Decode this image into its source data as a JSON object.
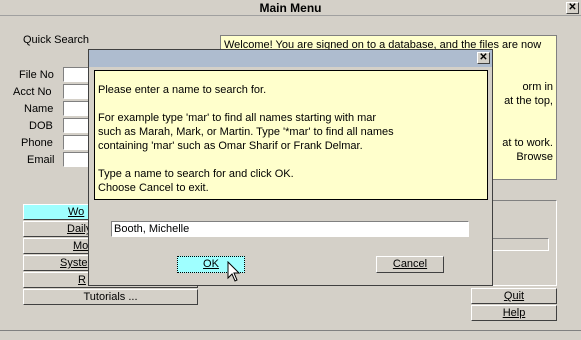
{
  "window": {
    "title": "Main Menu",
    "close_glyph": "✕"
  },
  "quick_search": {
    "title": "Quick Search",
    "fields": [
      {
        "label": "File No",
        "value": ""
      },
      {
        "label": "Acct No",
        "value": ""
      },
      {
        "label": "Name",
        "value": ""
      },
      {
        "label": "DOB",
        "value": ""
      },
      {
        "label": "Phone",
        "value": ""
      },
      {
        "label": "Email",
        "value": ""
      }
    ]
  },
  "welcome": {
    "lines": [
      "Welcome! You are signed on to a database, and the files are now",
      "",
      "",
      "orm in",
      "at the top,",
      "",
      "",
      "at to work.",
      "Browse"
    ]
  },
  "menu": {
    "items": [
      {
        "text": "Wo",
        "hotkey": ""
      },
      {
        "text": "Daily",
        "hotkey": ""
      },
      {
        "text": "Mo",
        "hotkey": ""
      },
      {
        "text": "Syste",
        "hotkey": ""
      },
      {
        "text": "R",
        "hotkey": ""
      },
      {
        "text": "Tutorials ...",
        "hotkey": "T"
      }
    ]
  },
  "right_buttons": {
    "quit": "Quit",
    "help": "Help"
  },
  "dialog": {
    "close_glyph": "✕",
    "message": [
      "Please enter a name to search for.",
      "",
      "For example type 'mar' to find all names starting with mar",
      "such as Marah, Mark, or Martin. Type '*mar' to find all names",
      "containing 'mar' such as Omar Sharif or Frank Delmar.",
      "",
      "Type a name to search for and click OK.",
      "Choose Cancel to exit."
    ],
    "input_value": "Booth, Michelle",
    "ok_label": "OK",
    "cancel_label": "Cancel"
  },
  "colors": {
    "dialog_message_bg": "#ffffcc",
    "selected_button_bg": "#9fffff",
    "dialog_title_bg": "#aebccf"
  }
}
